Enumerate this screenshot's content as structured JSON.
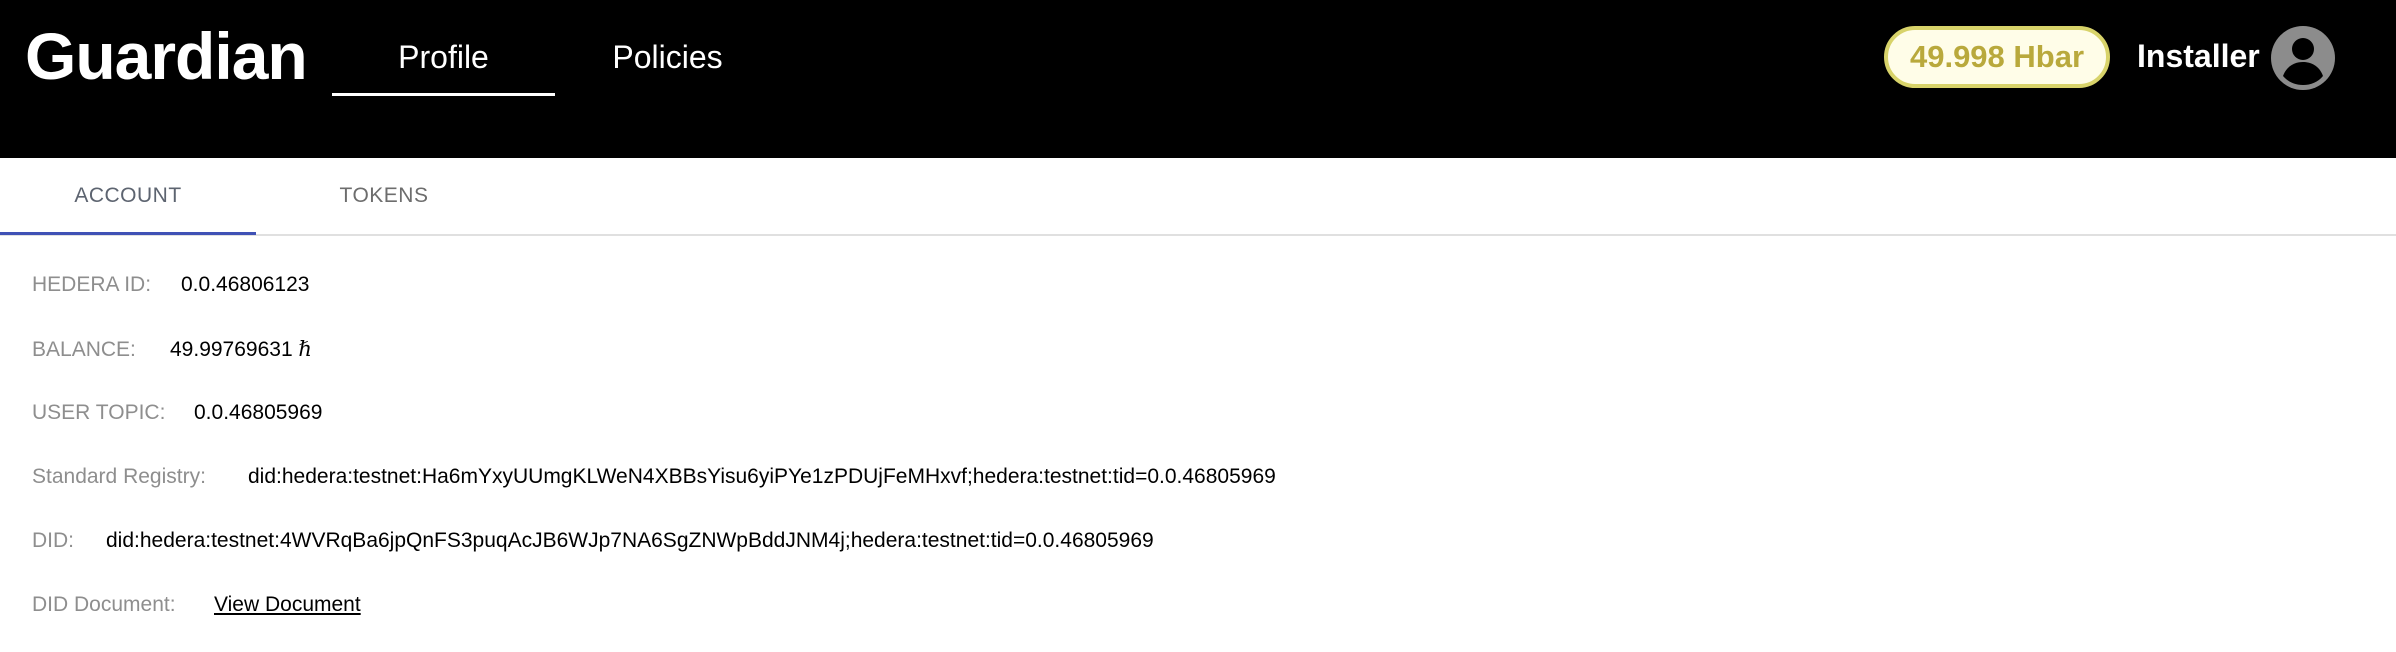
{
  "header": {
    "brand": "Guardian",
    "nav": [
      {
        "label": "Profile",
        "active": true
      },
      {
        "label": "Policies",
        "active": false
      }
    ],
    "balance_badge": "49.998 Hbar",
    "username": "Installer",
    "avatar_icon": "account-circle-icon"
  },
  "tabs": [
    {
      "label": "ACCOUNT",
      "active": true
    },
    {
      "label": "TOKENS",
      "active": false
    }
  ],
  "account": {
    "hedera_id": {
      "label": "HEDERA ID:",
      "value": "0.0.46806123"
    },
    "balance": {
      "label": "BALANCE:",
      "value": "49.99769631",
      "unit_symbol": "ℏ"
    },
    "user_topic": {
      "label": "USER TOPIC:",
      "value": "0.0.46805969"
    },
    "standard_registry": {
      "label": "Standard Registry:",
      "value": "did:hedera:testnet:Ha6mYxyUUmgKLWeN4XBBsYisu6yiPYe1zPDUjFeMHxvf;hedera:testnet:tid=0.0.46805969"
    },
    "did": {
      "label": "DID:",
      "value": "did:hedera:testnet:4WVRqBa6jpQnFS3puqAcJB6WJp7NA6SgZNWpBddJNM4j;hedera:testnet:tid=0.0.46805969"
    },
    "did_document": {
      "label": "DID Document:",
      "link_text": "View Document"
    }
  },
  "colors": {
    "header_bg": "#000000",
    "balance_text": "#b9a93c",
    "balance_border": "#d8d36a",
    "tab_indicator": "#3f51b5",
    "label_text": "#8e8e8e",
    "link": "#0000ee"
  }
}
